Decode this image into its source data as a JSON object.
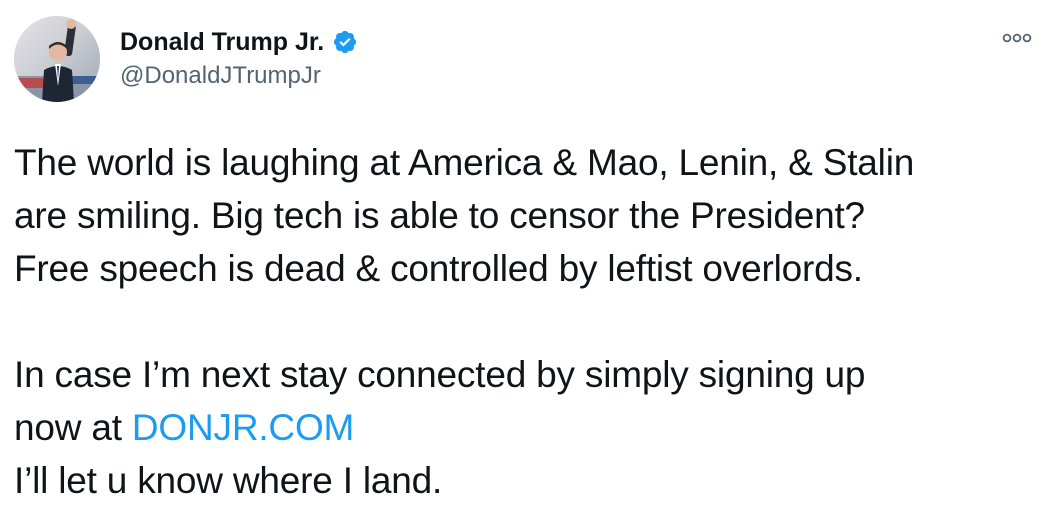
{
  "author": {
    "display_name": "Donald Trump Jr.",
    "handle": "@DonaldJTrumpJr",
    "verified": true,
    "avatar_icon": "profile-photo"
  },
  "menu": {
    "more_icon": "more-options-icon"
  },
  "tweet": {
    "paragraph1": [
      "The world is laughing at America & Mao, Lenin, & Stalin",
      "are smiling. Big tech is able to censor the President?",
      "Free speech is dead & controlled by leftist overlords."
    ],
    "paragraph2_line1": "In case I’m next stay connected by simply signing up",
    "paragraph2_line2_prefix": "now at ",
    "link_text": "DONJR.COM",
    "paragraph2_line3": "I’ll let u know where I land."
  },
  "colors": {
    "text": "#0f1419",
    "secondary_text": "#536471",
    "link": "#1d9bf0",
    "verified_badge": "#1d9bf0",
    "background": "#ffffff"
  }
}
